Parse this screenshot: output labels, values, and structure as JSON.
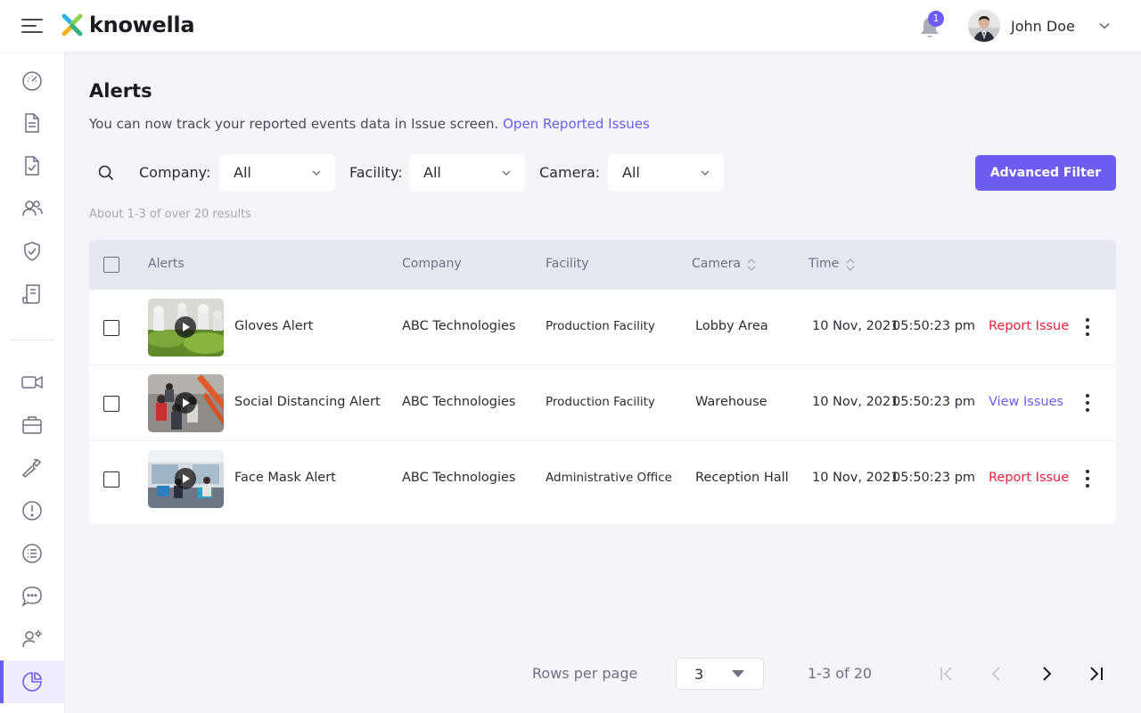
{
  "header": {
    "brand": "knowella",
    "notification_count": "1",
    "user_name": "John Doe"
  },
  "sidebar": {
    "items": [
      {
        "icon": "dashboard-gauge-icon"
      },
      {
        "icon": "document-icon"
      },
      {
        "icon": "checklist-document-icon"
      },
      {
        "icon": "users-icon"
      },
      {
        "icon": "shield-check-icon"
      },
      {
        "icon": "receipt-icon"
      },
      {
        "icon": "video-camera-icon"
      },
      {
        "icon": "briefcase-icon"
      },
      {
        "icon": "wrench-icon"
      },
      {
        "icon": "alert-circle-icon"
      },
      {
        "icon": "list-circle-icon"
      },
      {
        "icon": "chat-bubble-icon"
      },
      {
        "icon": "user-settings-icon"
      },
      {
        "icon": "pie-chart-icon",
        "active": true
      }
    ]
  },
  "main": {
    "title": "Alerts",
    "info_text": "You can now track your reported events data in Issue screen.",
    "info_link": "Open Reported Issues",
    "filters": {
      "company_label": "Company:",
      "company_value": "All",
      "facility_label": "Facility:",
      "facility_value": "All",
      "camera_label": "Camera:",
      "camera_value": "All",
      "advanced_filter": "Advanced Filter"
    },
    "results_count": "About 1-3 of over 20 results",
    "table": {
      "columns": [
        "Alerts",
        "Company",
        "Facility",
        "Camera",
        "Time"
      ],
      "rows": [
        {
          "alert": "Gloves Alert",
          "company": "ABC Technologies",
          "facility": "Production Facility",
          "camera": "Lobby Area",
          "date": "10 Nov, 2021",
          "time": "05:50:23 pm",
          "action": "Report Issue"
        },
        {
          "alert": "Social Distancing Alert",
          "company": "ABC Technologies",
          "facility": "Production Facility",
          "camera": "Warehouse",
          "date": "10 Nov, 2021",
          "time": "05:50:23 pm",
          "action": "View Issues"
        },
        {
          "alert": "Face Mask Alert",
          "company": "ABC Technologies",
          "facility": "Administrative Office",
          "camera": "Reception Hall",
          "date": "10 Nov, 2021",
          "time": "05:50:23 pm",
          "action": "Report Issue"
        }
      ]
    }
  },
  "pagination": {
    "rows_per_page_label": "Rows per page",
    "rows_per_page_value": "3",
    "range": "1-3 of 20"
  },
  "colors": {
    "accent": "#6c5cf0",
    "danger": "#e8233d",
    "header_bg": "#e5e8f0"
  }
}
